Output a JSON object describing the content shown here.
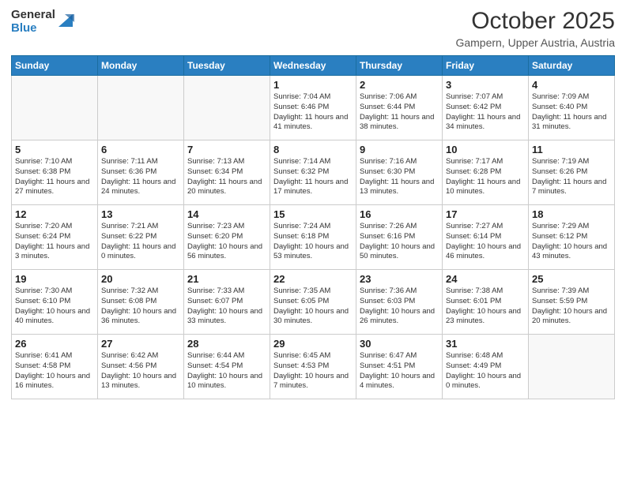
{
  "logo": {
    "general": "General",
    "blue": "Blue"
  },
  "title": "October 2025",
  "location": "Gampern, Upper Austria, Austria",
  "days_of_week": [
    "Sunday",
    "Monday",
    "Tuesday",
    "Wednesday",
    "Thursday",
    "Friday",
    "Saturday"
  ],
  "weeks": [
    [
      {
        "day": "",
        "info": ""
      },
      {
        "day": "",
        "info": ""
      },
      {
        "day": "",
        "info": ""
      },
      {
        "day": "1",
        "info": "Sunrise: 7:04 AM\nSunset: 6:46 PM\nDaylight: 11 hours and 41 minutes."
      },
      {
        "day": "2",
        "info": "Sunrise: 7:06 AM\nSunset: 6:44 PM\nDaylight: 11 hours and 38 minutes."
      },
      {
        "day": "3",
        "info": "Sunrise: 7:07 AM\nSunset: 6:42 PM\nDaylight: 11 hours and 34 minutes."
      },
      {
        "day": "4",
        "info": "Sunrise: 7:09 AM\nSunset: 6:40 PM\nDaylight: 11 hours and 31 minutes."
      }
    ],
    [
      {
        "day": "5",
        "info": "Sunrise: 7:10 AM\nSunset: 6:38 PM\nDaylight: 11 hours and 27 minutes."
      },
      {
        "day": "6",
        "info": "Sunrise: 7:11 AM\nSunset: 6:36 PM\nDaylight: 11 hours and 24 minutes."
      },
      {
        "day": "7",
        "info": "Sunrise: 7:13 AM\nSunset: 6:34 PM\nDaylight: 11 hours and 20 minutes."
      },
      {
        "day": "8",
        "info": "Sunrise: 7:14 AM\nSunset: 6:32 PM\nDaylight: 11 hours and 17 minutes."
      },
      {
        "day": "9",
        "info": "Sunrise: 7:16 AM\nSunset: 6:30 PM\nDaylight: 11 hours and 13 minutes."
      },
      {
        "day": "10",
        "info": "Sunrise: 7:17 AM\nSunset: 6:28 PM\nDaylight: 11 hours and 10 minutes."
      },
      {
        "day": "11",
        "info": "Sunrise: 7:19 AM\nSunset: 6:26 PM\nDaylight: 11 hours and 7 minutes."
      }
    ],
    [
      {
        "day": "12",
        "info": "Sunrise: 7:20 AM\nSunset: 6:24 PM\nDaylight: 11 hours and 3 minutes."
      },
      {
        "day": "13",
        "info": "Sunrise: 7:21 AM\nSunset: 6:22 PM\nDaylight: 11 hours and 0 minutes."
      },
      {
        "day": "14",
        "info": "Sunrise: 7:23 AM\nSunset: 6:20 PM\nDaylight: 10 hours and 56 minutes."
      },
      {
        "day": "15",
        "info": "Sunrise: 7:24 AM\nSunset: 6:18 PM\nDaylight: 10 hours and 53 minutes."
      },
      {
        "day": "16",
        "info": "Sunrise: 7:26 AM\nSunset: 6:16 PM\nDaylight: 10 hours and 50 minutes."
      },
      {
        "day": "17",
        "info": "Sunrise: 7:27 AM\nSunset: 6:14 PM\nDaylight: 10 hours and 46 minutes."
      },
      {
        "day": "18",
        "info": "Sunrise: 7:29 AM\nSunset: 6:12 PM\nDaylight: 10 hours and 43 minutes."
      }
    ],
    [
      {
        "day": "19",
        "info": "Sunrise: 7:30 AM\nSunset: 6:10 PM\nDaylight: 10 hours and 40 minutes."
      },
      {
        "day": "20",
        "info": "Sunrise: 7:32 AM\nSunset: 6:08 PM\nDaylight: 10 hours and 36 minutes."
      },
      {
        "day": "21",
        "info": "Sunrise: 7:33 AM\nSunset: 6:07 PM\nDaylight: 10 hours and 33 minutes."
      },
      {
        "day": "22",
        "info": "Sunrise: 7:35 AM\nSunset: 6:05 PM\nDaylight: 10 hours and 30 minutes."
      },
      {
        "day": "23",
        "info": "Sunrise: 7:36 AM\nSunset: 6:03 PM\nDaylight: 10 hours and 26 minutes."
      },
      {
        "day": "24",
        "info": "Sunrise: 7:38 AM\nSunset: 6:01 PM\nDaylight: 10 hours and 23 minutes."
      },
      {
        "day": "25",
        "info": "Sunrise: 7:39 AM\nSunset: 5:59 PM\nDaylight: 10 hours and 20 minutes."
      }
    ],
    [
      {
        "day": "26",
        "info": "Sunrise: 6:41 AM\nSunset: 4:58 PM\nDaylight: 10 hours and 16 minutes."
      },
      {
        "day": "27",
        "info": "Sunrise: 6:42 AM\nSunset: 4:56 PM\nDaylight: 10 hours and 13 minutes."
      },
      {
        "day": "28",
        "info": "Sunrise: 6:44 AM\nSunset: 4:54 PM\nDaylight: 10 hours and 10 minutes."
      },
      {
        "day": "29",
        "info": "Sunrise: 6:45 AM\nSunset: 4:53 PM\nDaylight: 10 hours and 7 minutes."
      },
      {
        "day": "30",
        "info": "Sunrise: 6:47 AM\nSunset: 4:51 PM\nDaylight: 10 hours and 4 minutes."
      },
      {
        "day": "31",
        "info": "Sunrise: 6:48 AM\nSunset: 4:49 PM\nDaylight: 10 hours and 0 minutes."
      },
      {
        "day": "",
        "info": ""
      }
    ]
  ]
}
